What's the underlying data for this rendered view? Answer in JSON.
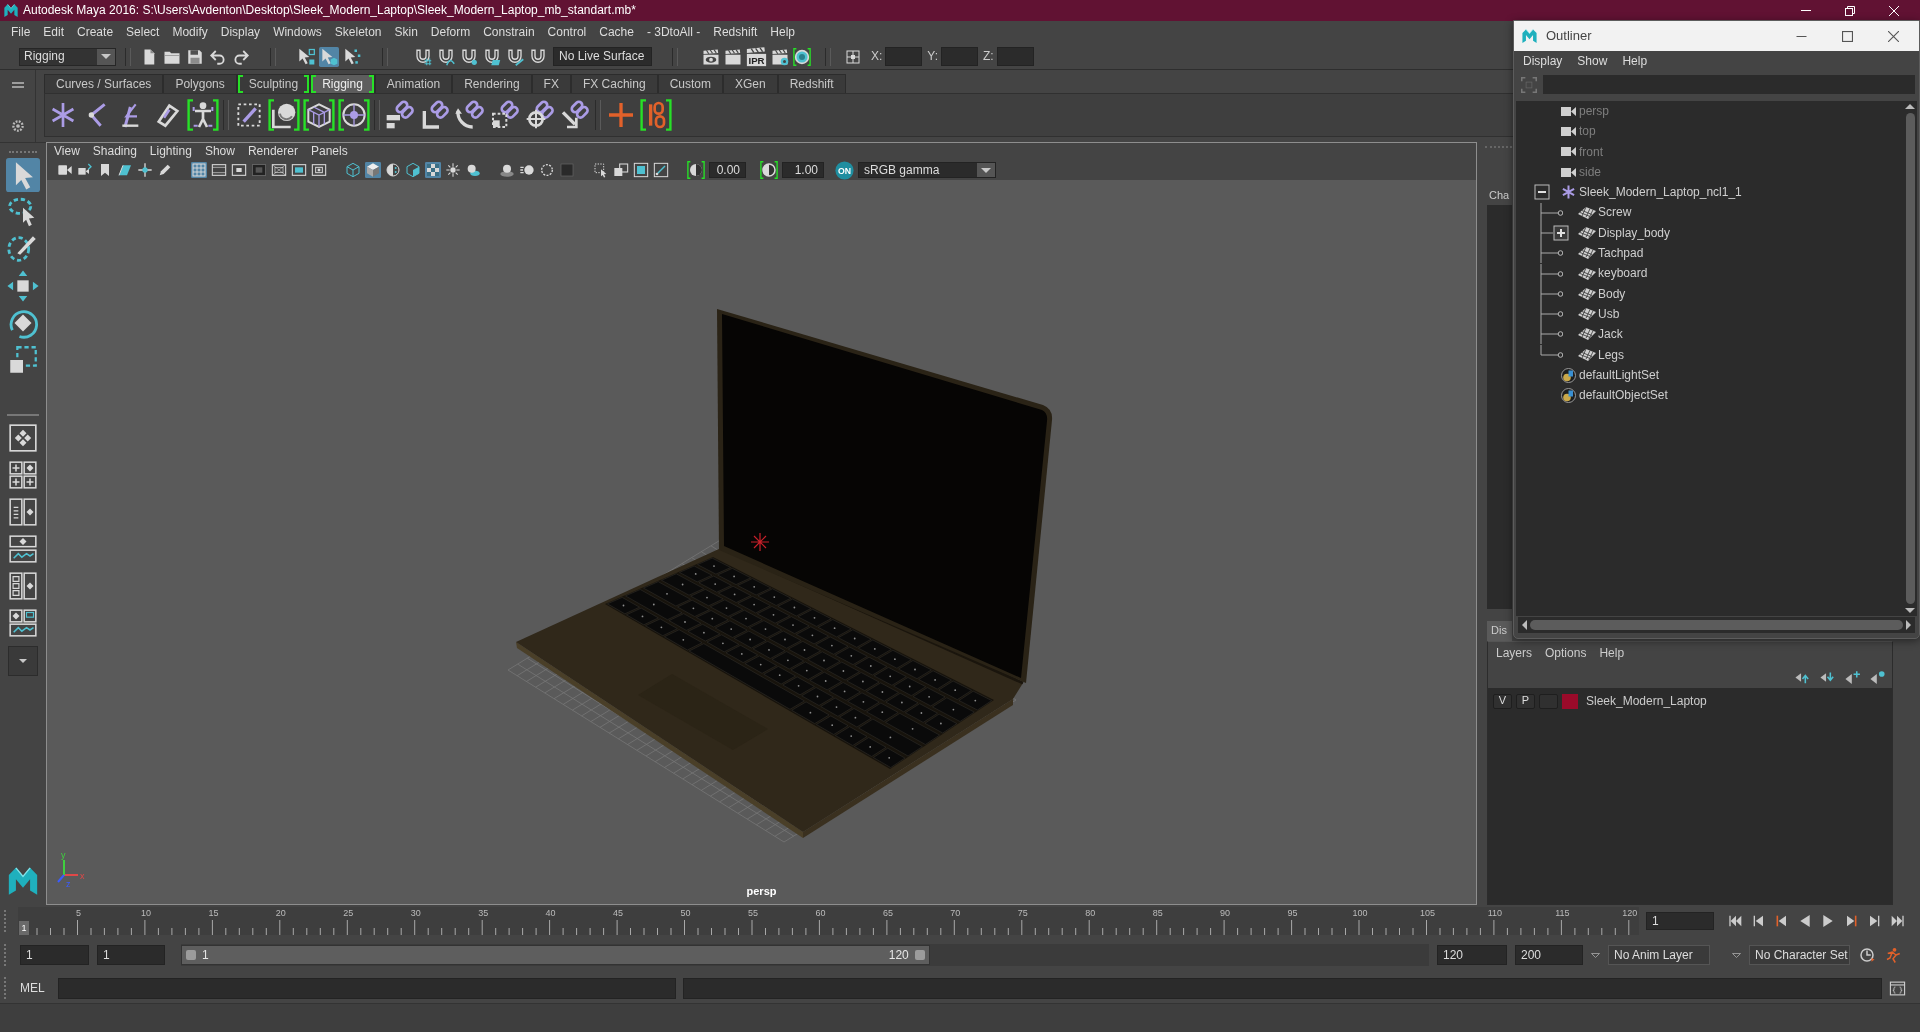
{
  "window": {
    "title": "Autodesk Maya 2016: S:\\Users\\Avdenton\\Desktop\\Sleek_Modern_Laptop\\Sleek_Modern_Laptop_mb_standart.mb*"
  },
  "menu_bar": [
    "File",
    "Edit",
    "Create",
    "Select",
    "Modify",
    "Display",
    "Windows",
    "Skeleton",
    "Skin",
    "Deform",
    "Constrain",
    "Control",
    "Cache",
    "- 3DtoAll -",
    "Redshift",
    "Help"
  ],
  "status_line": {
    "menu_set": "Rigging",
    "selection_modes": [
      {
        "kind": "hierarchy",
        "selected": false
      },
      {
        "kind": "object",
        "selected": true
      },
      {
        "kind": "component",
        "selected": false
      }
    ],
    "live_surface": "No Live Surface",
    "render_tools": [
      {
        "kind": "render-view",
        "bracketed": false
      },
      {
        "kind": "render",
        "bracketed": false
      },
      {
        "kind": "ipr",
        "label": "IPR",
        "bracketed": false
      },
      {
        "kind": "render-settings",
        "bracketed": false
      },
      {
        "kind": "hypershade",
        "bracketed": true
      }
    ],
    "coordinate_labels": [
      "X:",
      "Y:",
      "Z:"
    ]
  },
  "shelf": {
    "tabs": [
      {
        "label": "Curves / Surfaces",
        "selected": false,
        "bracketed": false
      },
      {
        "label": "Polygons",
        "selected": false,
        "bracketed": false
      },
      {
        "label": "Sculpting",
        "selected": false,
        "bracketed": true
      },
      {
        "label": "Rigging",
        "selected": true,
        "bracketed": true
      },
      {
        "label": "Animation",
        "selected": false,
        "bracketed": false
      },
      {
        "label": "Rendering",
        "selected": false,
        "bracketed": false
      },
      {
        "label": "FX",
        "selected": false,
        "bracketed": false
      },
      {
        "label": "FX Caching",
        "selected": false,
        "bracketed": false
      },
      {
        "label": "Custom",
        "selected": false,
        "bracketed": false
      },
      {
        "label": "XGen",
        "selected": false,
        "bracketed": false
      },
      {
        "label": "Redshift",
        "selected": false,
        "bracketed": false
      }
    ],
    "tool_groups": [
      [
        {
          "kind": "joint",
          "bracketed": false
        },
        {
          "kind": "ik-handle",
          "bracketed": false
        },
        {
          "kind": "ik-spline",
          "bracketed": false
        },
        {
          "kind": "bone",
          "bracketed": false
        },
        {
          "kind": "humanik",
          "bracketed": true
        }
      ],
      [
        {
          "kind": "bind-skin",
          "bracketed": false
        },
        {
          "kind": "smooth-bind",
          "bracketed": true
        },
        {
          "kind": "lattice",
          "bracketed": true
        },
        {
          "kind": "wrap",
          "bracketed": true
        }
      ],
      [
        {
          "kind": "parent-constraint",
          "bracketed": false
        },
        {
          "kind": "point-constraint",
          "bracketed": false
        },
        {
          "kind": "orient-constraint",
          "bracketed": false
        },
        {
          "kind": "scale-constraint",
          "bracketed": false
        },
        {
          "kind": "aim-constraint",
          "bracketed": false
        },
        {
          "kind": "pole-constraint",
          "bracketed": false
        }
      ],
      [
        {
          "kind": "cross",
          "bracketed": false
        },
        {
          "kind": "break-link",
          "bracketed": true
        }
      ]
    ]
  },
  "toolbox": {
    "tools": [
      {
        "kind": "select",
        "selected": true
      },
      {
        "kind": "lasso",
        "selected": false
      },
      {
        "kind": "paint-select",
        "selected": false
      },
      {
        "kind": "move",
        "selected": false
      },
      {
        "kind": "rotate",
        "selected": false
      },
      {
        "kind": "scale",
        "selected": false
      }
    ]
  },
  "viewport": {
    "menu": [
      "View",
      "Shading",
      "Lighting",
      "Show",
      "Renderer",
      "Panels"
    ],
    "toolbar_groups": [
      [
        {
          "kind": "camera",
          "on": false
        },
        {
          "kind": "camera-attributes",
          "on": false
        },
        {
          "kind": "bookmark",
          "on": false
        },
        {
          "kind": "image-plane",
          "on": false
        },
        {
          "kind": "pan-zoom",
          "on": false
        },
        {
          "kind": "grease-pencil",
          "on": false
        }
      ],
      [
        {
          "kind": "grid",
          "on": true
        },
        {
          "kind": "film-gate",
          "on": false
        },
        {
          "kind": "resolution-gate",
          "on": false
        },
        {
          "kind": "gate-mask",
          "on": false
        },
        {
          "kind": "field-chart",
          "on": false
        },
        {
          "kind": "safe-action",
          "on": false
        },
        {
          "kind": "safe-title",
          "on": false
        }
      ],
      [
        {
          "kind": "wireframe",
          "on": false
        },
        {
          "kind": "smooth-shade",
          "on": true
        },
        {
          "kind": "wire-on-shaded",
          "on": false
        },
        {
          "kind": "textured",
          "on": false
        },
        {
          "kind": "checker",
          "on": true
        },
        {
          "kind": "lights",
          "on": false
        },
        {
          "kind": "shadows",
          "on": false
        }
      ],
      [
        {
          "kind": "ambient-occlusion",
          "on": false
        },
        {
          "kind": "motion-blur",
          "on": false
        },
        {
          "kind": "anti-alias",
          "on": false
        },
        {
          "kind": "depth-of-field",
          "on": false
        }
      ],
      [
        {
          "kind": "isolate",
          "on": false
        },
        {
          "kind": "xray",
          "on": false
        },
        {
          "kind": "xray-active",
          "on": false
        },
        {
          "kind": "xray-joints",
          "on": false
        }
      ]
    ],
    "exposure": "0.00",
    "gamma": "1.00",
    "color_management": "ON",
    "color_space": "sRGB gamma",
    "camera_label": "persp",
    "axes": [
      {
        "label": "x",
        "color": "#e04848"
      },
      {
        "label": "y",
        "color": "#3fcf3f"
      },
      {
        "label": "z",
        "color": "#3b5cff"
      }
    ]
  },
  "channel_box": {
    "tab_label": "Cha"
  },
  "layer_editor": {
    "tab_label": "Dis",
    "menu": [
      "Layers",
      "Options",
      "Help"
    ],
    "layers": [
      {
        "visible": "V",
        "playback": "P",
        "color": "#9a0a2a",
        "name": "Sleek_Modern_Laptop"
      }
    ]
  },
  "outliner": {
    "title": "Outliner",
    "menu": [
      "Display",
      "Show",
      "Help"
    ],
    "items": [
      {
        "label": "persp",
        "kind": "camera",
        "hidden": true,
        "expandable": false,
        "expanded": false
      },
      {
        "label": "top",
        "kind": "camera",
        "hidden": true,
        "expandable": false,
        "expanded": false
      },
      {
        "label": "front",
        "kind": "camera",
        "hidden": true,
        "expandable": false,
        "expanded": false
      },
      {
        "label": "side",
        "kind": "camera",
        "hidden": true,
        "expandable": false,
        "expanded": false
      },
      {
        "label": "Sleek_Modern_Laptop_ncl1_1",
        "kind": "transform",
        "hidden": false,
        "expandable": true,
        "expanded": true,
        "children": [
          {
            "label": "Screw",
            "kind": "mesh",
            "hidden": false,
            "expandable": false,
            "expanded": false
          },
          {
            "label": "Display_body",
            "kind": "mesh",
            "hidden": false,
            "expandable": true,
            "expanded": false
          },
          {
            "label": "Tachpad",
            "kind": "mesh",
            "hidden": false,
            "expandable": false,
            "expanded": false
          },
          {
            "label": "keyboard",
            "kind": "mesh",
            "hidden": false,
            "expandable": false,
            "expanded": false
          },
          {
            "label": "Body",
            "kind": "mesh",
            "hidden": false,
            "expandable": false,
            "expanded": false
          },
          {
            "label": "Usb",
            "kind": "mesh",
            "hidden": false,
            "expandable": false,
            "expanded": false
          },
          {
            "label": "Jack",
            "kind": "mesh",
            "hidden": false,
            "expandable": false,
            "expanded": false
          },
          {
            "label": "Legs",
            "kind": "mesh",
            "hidden": false,
            "expandable": false,
            "expanded": false
          }
        ]
      },
      {
        "label": "defaultLightSet",
        "kind": "set",
        "hidden": false,
        "expandable": false,
        "expanded": false
      },
      {
        "label": "defaultObjectSet",
        "kind": "set",
        "hidden": false,
        "expandable": false,
        "expanded": false
      }
    ]
  },
  "time_slider": {
    "ticks": [
      "5",
      "10",
      "15",
      "20",
      "25",
      "30",
      "35",
      "40",
      "45",
      "50",
      "55",
      "60",
      "65",
      "70",
      "75",
      "80",
      "85",
      "90",
      "95",
      "100",
      "105",
      "110",
      "115",
      "120"
    ],
    "current_frame_marker": "1",
    "level": 0,
    "current_frame": "1"
  },
  "range_slider": {
    "start_time": "1",
    "playback_start": "1",
    "level": 0.6,
    "range_start_label": "1",
    "range_end_label": "120",
    "playback_end": "120",
    "end_time": "200",
    "anim_layer": "No Anim Layer",
    "character_set": "No Character Set"
  },
  "command_line": {
    "language": "MEL"
  }
}
